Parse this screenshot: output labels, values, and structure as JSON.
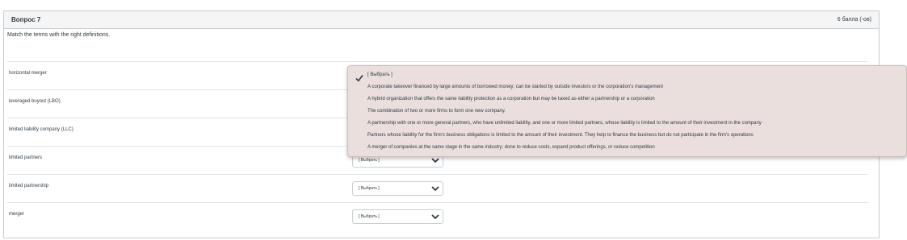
{
  "question": {
    "title": "Вопрос 7",
    "points": "6 балла (-ов)",
    "instructions": "Match the terms with the right definitions."
  },
  "rows": [
    {
      "term": "horizontal merger",
      "selected": "[ Выбрать ]"
    },
    {
      "term": "leveraged buyout (LBO)",
      "selected": "[ Выбрать ]"
    },
    {
      "term": "limited liability company (LLC)",
      "selected": "[ Выбрать ]"
    },
    {
      "term": "limited partners",
      "selected": "[ Выбрать ]"
    },
    {
      "term": "limited partnership",
      "selected": "[ Выбрать ]"
    },
    {
      "term": "merger",
      "selected": "[ Выбрать ]"
    }
  ],
  "dropdown": {
    "open_for_row": "horizontal merger",
    "options": [
      "[ Выбрать ]",
      "A corporate takeover financed by large amounts of borrowed money; can be started by outside investors or the corporation's management",
      "A hybrid organization that offers the same liability protection as a corporation but may be taxed as either a partnership or a corporation",
      "The combination of two or more firms to form one new company.",
      "A partnership with one or more general partners, who have unlimited liability, and one or more limited partners, whose liability is limited to the amount of their investment in the company",
      "Partners whose liability for the firm's business obligations is limited to the amount of their investment. They help to finance the business but do not participate in the firm's operations",
      "A merger of companies at the same stage in the same industry; done to reduce costs, expand product offerings, or reduce competition"
    ],
    "checked_option": "[ Выбрать ]",
    "background_color": "#eadfdc"
  }
}
